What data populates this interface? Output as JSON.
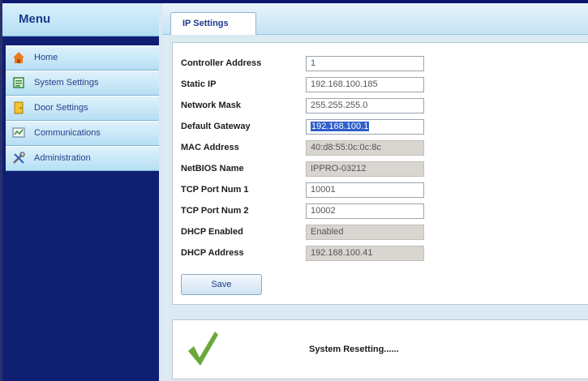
{
  "sidebar": {
    "title": "Menu",
    "items": [
      {
        "label": "Home",
        "icon": "home-icon"
      },
      {
        "label": "System Settings",
        "icon": "system-settings-icon"
      },
      {
        "label": "Door Settings",
        "icon": "door-icon"
      },
      {
        "label": "Communications",
        "icon": "communications-icon"
      },
      {
        "label": "Administration",
        "icon": "tools-icon"
      }
    ]
  },
  "tab": {
    "label": "IP Settings"
  },
  "form": {
    "fields": [
      {
        "label": "Controller Address",
        "value": "1",
        "kind": "editable"
      },
      {
        "label": "Static IP",
        "value": "192.168.100.185",
        "kind": "editable"
      },
      {
        "label": "Network Mask",
        "value": "255.255.255.0",
        "kind": "editable"
      },
      {
        "label": "Default Gateway",
        "value": "192.168.100.1",
        "kind": "editable-selected"
      },
      {
        "label": "MAC Address",
        "value": "40:d8:55:0c:0c:8c",
        "kind": "readonly"
      },
      {
        "label": "NetBIOS Name",
        "value": "IPPRO-03212",
        "kind": "readonly"
      },
      {
        "label": "TCP Port Num 1",
        "value": "10001",
        "kind": "editable"
      },
      {
        "label": "TCP Port Num 2",
        "value": "10002",
        "kind": "editable"
      },
      {
        "label": "DHCP Enabled",
        "value": "Enabled",
        "kind": "readonly"
      },
      {
        "label": "DHCP Address",
        "value": "192.168.100.41",
        "kind": "readonly"
      }
    ],
    "save_label": "Save"
  },
  "status": {
    "message": "System Resetting......",
    "icon": "checkmark-icon",
    "icon_color": "#6aa83a"
  },
  "colors": {
    "sidebar_bg": "#0f1f72",
    "accent": "#1d3b8b",
    "selection": "#2f5fc9"
  }
}
